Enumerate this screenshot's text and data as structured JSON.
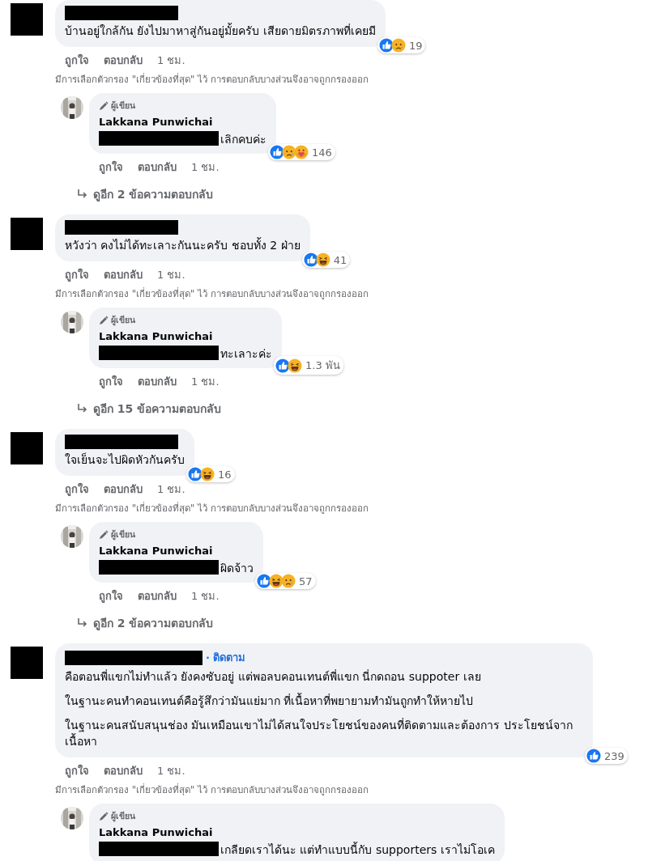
{
  "threads": [
    {
      "comment": {
        "paragraphs": [
          "บ้านอยู่ใกล้กัน ยังไปมาหาสู่กันอยู่มั้ยครับ เสียดายมิตรภาพที่เคยมี"
        ],
        "reactions": [
          {
            "kind": "like"
          },
          {
            "kind": "sad"
          }
        ],
        "count": "19"
      },
      "actions": {
        "like": "ถูกใจ",
        "reply": "ตอบกลับ",
        "time": "1 ชม."
      },
      "filter_note": "มีการเลือกตัวกรอง \"เกี่ยวข้องที่สุด\" ไว้ การตอบกลับบางส่วนจึงอาจถูกกรองออก",
      "reply": {
        "badge": "ผู้เขียน",
        "author": "Lakkana Punwichai",
        "text": "เลิกคบค่ะ",
        "reactions": [
          {
            "kind": "like"
          },
          {
            "kind": "sad"
          },
          {
            "kind": "care"
          }
        ],
        "count": "146",
        "actions": {
          "like": "ถูกใจ",
          "reply": "ตอบกลับ",
          "time": "1 ชม."
        }
      },
      "more_replies": "ดูอีก 2 ข้อความตอบกลับ"
    },
    {
      "comment": {
        "paragraphs": [
          "หวังว่า คงไม่ได้ทะเลาะกันนะครับ ชอบทั้ง 2 ฝ่าย"
        ],
        "reactions": [
          {
            "kind": "like"
          },
          {
            "kind": "haha"
          }
        ],
        "count": "41"
      },
      "actions": {
        "like": "ถูกใจ",
        "reply": "ตอบกลับ",
        "time": "1 ชม."
      },
      "filter_note": "มีการเลือกตัวกรอง \"เกี่ยวข้องที่สุด\" ไว้ การตอบกลับบางส่วนจึงอาจถูกกรองออก",
      "reply": {
        "badge": "ผู้เขียน",
        "author": "Lakkana Punwichai",
        "text": "ทะเลาะค่ะ",
        "reactions": [
          {
            "kind": "like"
          },
          {
            "kind": "haha"
          }
        ],
        "count": "1.3 พัน",
        "actions": {
          "like": "ถูกใจ",
          "reply": "ตอบกลับ",
          "time": "1 ชม."
        }
      },
      "more_replies": "ดูอีก 15 ข้อความตอบกลับ"
    },
    {
      "comment": {
        "paragraphs": [
          "ใจเย็นจะไปผิดหัวกันครับ"
        ],
        "reactions": [
          {
            "kind": "like"
          },
          {
            "kind": "haha"
          }
        ],
        "count": "16"
      },
      "actions": {
        "like": "ถูกใจ",
        "reply": "ตอบกลับ",
        "time": "1 ชม."
      },
      "filter_note": "มีการเลือกตัวกรอง \"เกี่ยวข้องที่สุด\" ไว้ การตอบกลับบางส่วนจึงอาจถูกกรองออก",
      "reply": {
        "badge": "ผู้เขียน",
        "author": "Lakkana Punwichai",
        "text": "ผิดจ้าว",
        "reactions": [
          {
            "kind": "like"
          },
          {
            "kind": "haha"
          },
          {
            "kind": "sad"
          }
        ],
        "count": "57",
        "actions": {
          "like": "ถูกใจ",
          "reply": "ตอบกลับ",
          "time": "1 ชม."
        }
      },
      "more_replies": "ดูอีก 2 ข้อความตอบกลับ"
    },
    {
      "comment": {
        "follow": "· ติดตาม",
        "paragraphs": [
          "คือตอนพี่แขกไม่ทำแล้ว ยังคงซับอยู่ แต่พอลบคอนเทนต์พี่แขก นี่กดถอน suppoter เลย",
          "ในฐานะคนทำคอนเทนต์คือรู้สึกว่ามันแย่มาก ที่เนื้อหาที่พยายามทำมันถูกทำให้หายไป",
          "ในฐานะคนสนับสนุนช่อง มันเหมือนเขาไม่ได้สนใจประโยชน์ของคนที่ติดตามและต้องการ ประโยชน์จากเนื้อหา"
        ],
        "reactions": [
          {
            "kind": "like"
          }
        ],
        "count": "239"
      },
      "actions": {
        "like": "ถูกใจ",
        "reply": "ตอบกลับ",
        "time": "1 ชม."
      },
      "filter_note": "มีการเลือกตัวกรอง \"เกี่ยวข้องที่สุด\" ไว้ การตอบกลับบางส่วนจึงอาจถูกกรองออก",
      "reply": {
        "badge": "ผู้เขียน",
        "author": "Lakkana Punwichai",
        "text": "เกลียดเราได้นะ แต่ทำแบบนี้กับ supporters เราไม่โอเค"
      }
    }
  ]
}
